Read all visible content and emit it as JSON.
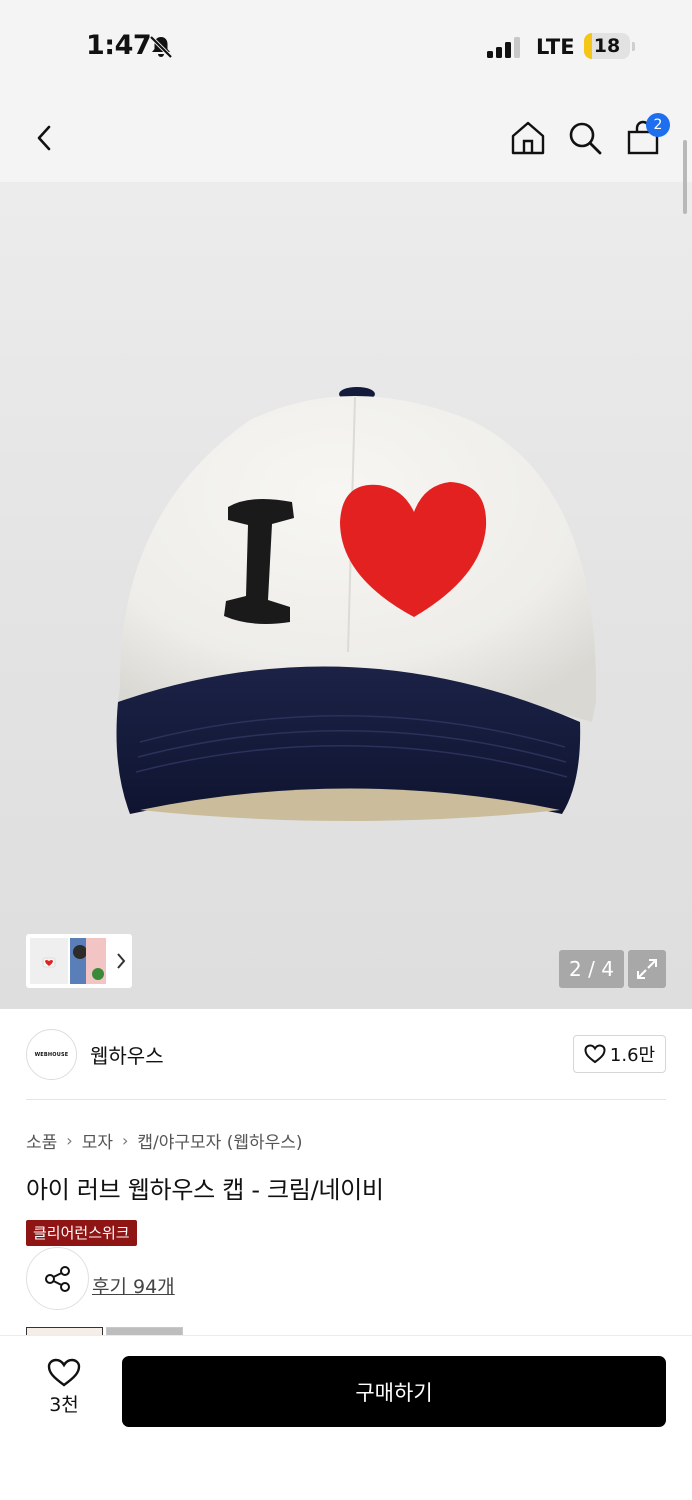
{
  "status_bar": {
    "time": "1:47",
    "network": "LTE",
    "battery_level": "18",
    "battery_fraction": 0.18,
    "icons": [
      "bell-slash-icon",
      "signal-icon"
    ]
  },
  "nav": {
    "icons": [
      "back-icon",
      "home-icon",
      "search-icon",
      "cart-icon"
    ],
    "cart_count": "2"
  },
  "gallery": {
    "counter": "2 / 4",
    "thumb_icon": "chevron-right-icon",
    "expand_icon": "expand-icon"
  },
  "brand": {
    "logo_text": "WEBHOUSE",
    "name": "웹하우스",
    "like_count": "1.6만"
  },
  "breadcrumb": [
    "소품",
    "모자",
    "캡/야구모자 (웹하우스)"
  ],
  "product": {
    "title": "아이 러브 웹하우스 캡 - 크림/네이비",
    "tag": "클리어런스위크",
    "review_link": "후기 94개"
  },
  "bottom_bar": {
    "wish_count": "3천",
    "buy_label": "구매하기"
  },
  "colors": {
    "cap_cream": "#f2f1ee",
    "cap_navy": "#141a3a",
    "heart_red": "#e32121",
    "badge_blue": "#1e6ff0",
    "tag_red": "#8f1414"
  }
}
